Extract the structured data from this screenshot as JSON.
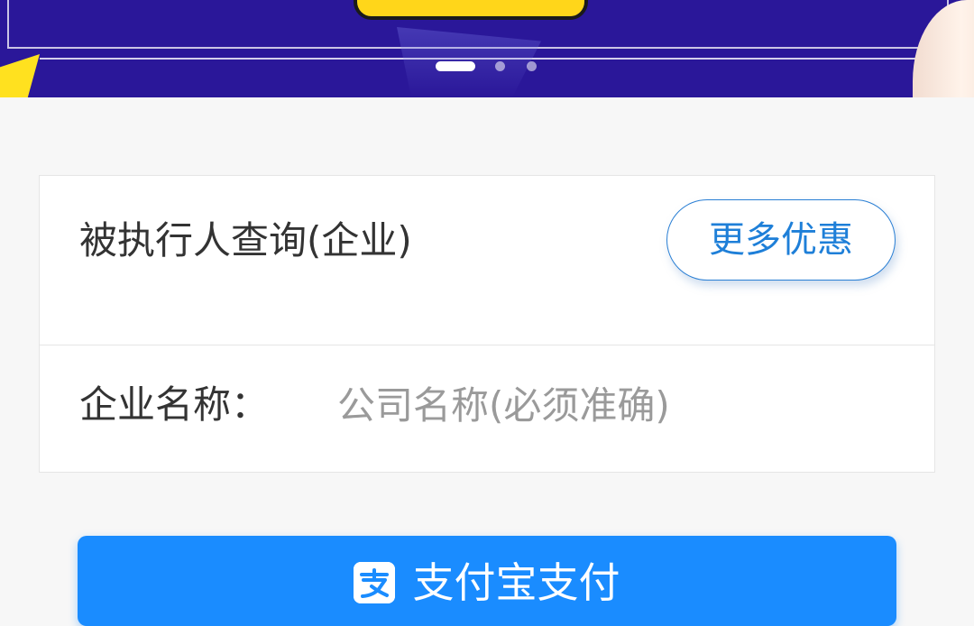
{
  "banner": {
    "slides_total": 3,
    "active_slide": 1
  },
  "query": {
    "title": "被执行人查询(企业)",
    "promo_button_label": "更多优惠"
  },
  "form": {
    "company_label": "企业名称：",
    "company_value": "",
    "company_placeholder": "公司名称(必须准确)"
  },
  "payment": {
    "button_label": "支付宝支付",
    "icon": "alipay-icon"
  },
  "colors": {
    "banner_bg": "#2a1799",
    "accent_blue": "#1a8cff",
    "promo_border": "#2a7fd4",
    "text_dark": "#333333",
    "placeholder": "#9a9a9a"
  }
}
